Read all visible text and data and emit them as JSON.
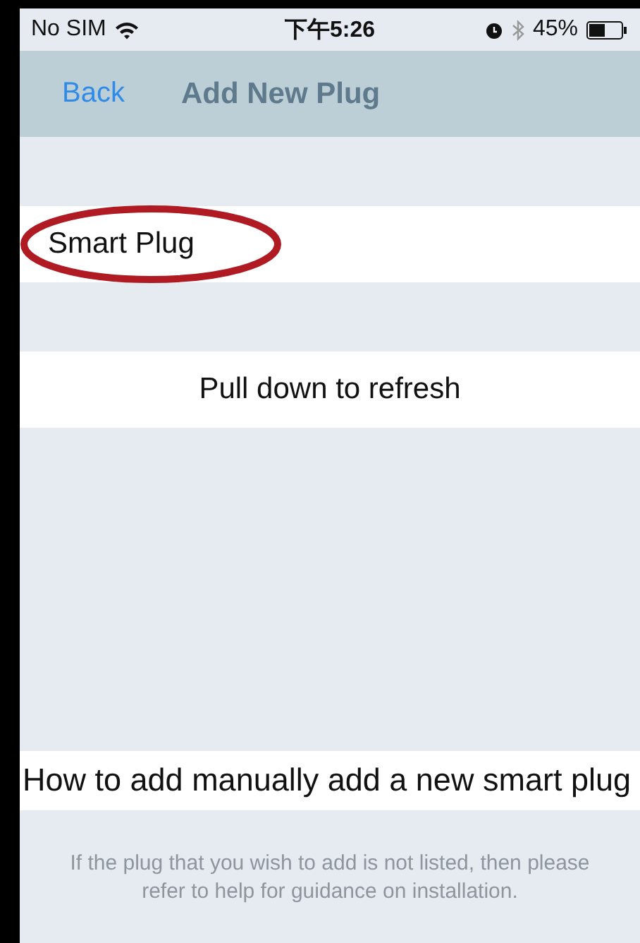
{
  "status_bar": {
    "carrier": "No SIM",
    "time": "下午5:26",
    "battery": "45%"
  },
  "nav_bar": {
    "back": "Back",
    "title": "Add New Plug"
  },
  "devices": [
    {
      "name": "Smart Plug",
      "circled": true
    }
  ],
  "refresh_row": {
    "label": "Pull down to refresh"
  },
  "manual_row": {
    "label": "How to add manually add a new smart plug"
  },
  "footer": {
    "note": "If the plug that you wish to add is not listed, then please refer to help for guidance on installation."
  }
}
